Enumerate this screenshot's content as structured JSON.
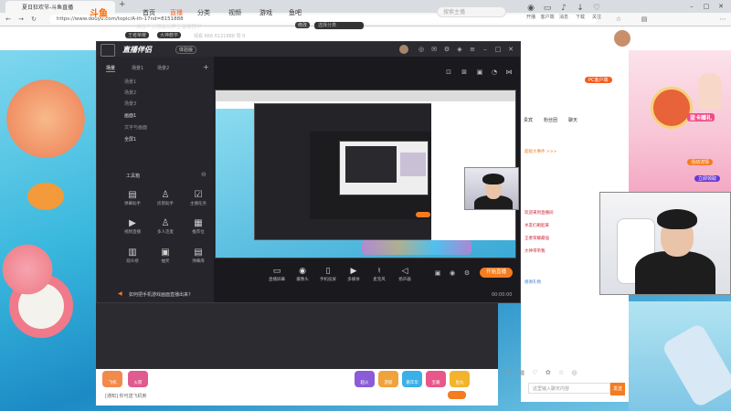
{
  "browser": {
    "tab_title": "夏日狂欢节-斗鱼直播",
    "url": "https://www.douyu.com/topic/A-th-17nd=8151888",
    "add_tab": "+"
  },
  "douyu": {
    "logo": "斗鱼",
    "nav": [
      "首页",
      "直播",
      "分类",
      "视频",
      "游戏",
      "鱼吧"
    ],
    "search_placeholder": "搜索主播",
    "tools": [
      "开播",
      "客户端",
      "消息",
      "下载",
      "关注",
      "历史"
    ]
  },
  "obs": {
    "logo": "直播伴侣",
    "version": "体验版",
    "tabs": [
      "场景",
      "场景1",
      "场景2"
    ],
    "sources": [
      "场景1",
      "场景2",
      "场景3",
      "画面1",
      "文字与画面",
      "全屏1"
    ],
    "toolbox_label": "工具箱",
    "tools": [
      "弹幕助手",
      "房管助手",
      "主播任务",
      "视频直播",
      "多人连麦",
      "推荐位",
      "观众榜",
      "抽奖",
      "弹幕库"
    ],
    "stream_title": "峡谷千分顶级玩梦王者局教学",
    "stream_cat": "修改",
    "stream_cat2": "选择分类",
    "tag1": "王者荣耀",
    "tag2": "大神教学",
    "stats": "观看 666  6121888  赞 0",
    "bottom": [
      "直播屏幕",
      "摄像头",
      "手机投屏",
      "多媒体",
      "麦克风",
      "扬声器"
    ],
    "golive": "开始直播",
    "notice": "如何把手机游戏画面直播出来?",
    "timer": "00:00:00"
  },
  "room": {
    "anchor_tag": "PC客户端",
    "tabs": [
      "贵宾",
      "粉丝团",
      "聊天"
    ],
    "chat": [
      "超级大事件 >>>",
      "欢迎来到直播间",
      "水友们刷起来",
      "王者荣耀最强",
      "大神带带我",
      "感谢礼物"
    ],
    "input_placeholder": "这里输入聊天内容",
    "send": "发送"
  },
  "promo": {
    "title": "蓝卡赠礼",
    "btn1": "立即领取",
    "btn2": "活动详情"
  },
  "giftbar": {
    "gifts": [
      "飞机",
      "火箭",
      "超火",
      "游艇",
      "嘉年华",
      "宝箱",
      "鱼丸"
    ],
    "note": "[通知] 你可送飞机到"
  }
}
